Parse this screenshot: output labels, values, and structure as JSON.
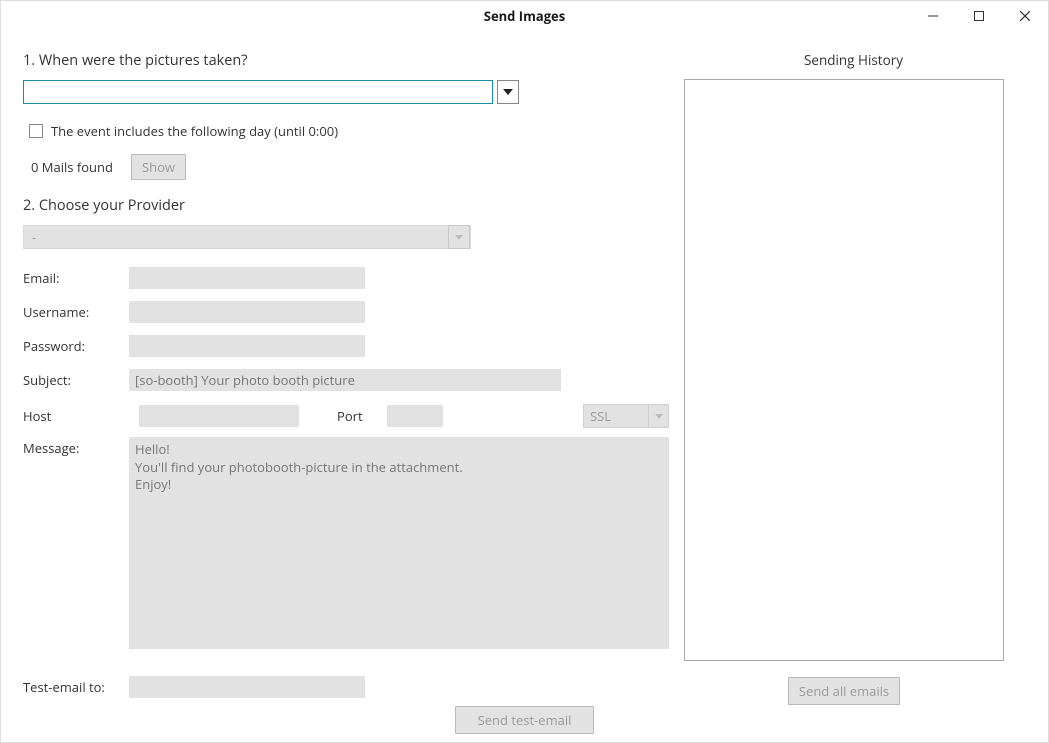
{
  "window": {
    "title": "Send Images"
  },
  "section1": {
    "heading": "1. When were the pictures taken?",
    "date_value": "",
    "include_next_day_label": "The event includes the following day (until 0:00)",
    "mails_found_text": "0 Mails found",
    "show_btn": "Show"
  },
  "section2": {
    "heading": "2. Choose your Provider",
    "provider_value": "-"
  },
  "form": {
    "email_label": "Email:",
    "username_label": "Username:",
    "password_label": "Password:",
    "subject_label": "Subject:",
    "subject_placeholder": "[so-booth] Your photo booth picture",
    "host_label": "Host",
    "port_label": "Port",
    "ssl_value": "SSL",
    "message_label": "Message:",
    "message_placeholder": "Hello!\nYou'll find your photobooth-picture in the attachment.\nEnjoy!",
    "test_email_label": "Test-email to:"
  },
  "buttons": {
    "send_test": "Send test-email",
    "send_all": "Send all emails"
  },
  "right": {
    "history_title": "Sending History"
  }
}
